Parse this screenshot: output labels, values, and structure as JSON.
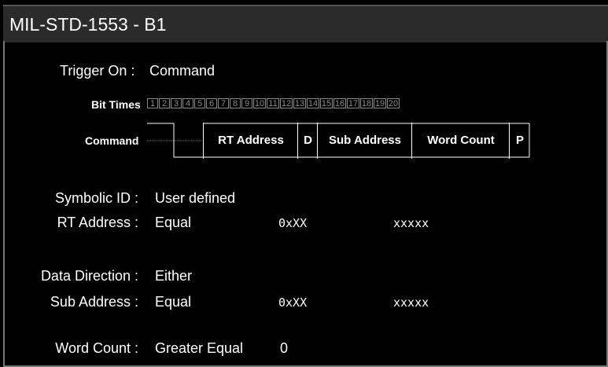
{
  "window": {
    "title": "MIL-STD-1553 - B1"
  },
  "trigger": {
    "label": "Trigger On :",
    "value": "Command"
  },
  "diagram": {
    "bit_times_label": "Bit Times",
    "bits": [
      "1",
      "2",
      "3",
      "4",
      "5",
      "6",
      "7",
      "8",
      "9",
      "10",
      "11",
      "12",
      "13",
      "14",
      "15",
      "16",
      "17",
      "18",
      "19",
      "20"
    ],
    "command_label": "Command",
    "fields": {
      "rt_address": "RT Address",
      "d": "D",
      "sub_address": "Sub Address",
      "word_count": "Word Count",
      "p": "P"
    }
  },
  "symbolic_id": {
    "label": "Symbolic ID :",
    "value": "User defined"
  },
  "rt_address": {
    "label": "RT Address :",
    "mode": "Equal",
    "hex": "0xXX",
    "bin": "xxxxx"
  },
  "data_direction": {
    "label": "Data Direction :",
    "value": "Either"
  },
  "sub_address": {
    "label": "Sub Address :",
    "mode": "Equal",
    "hex": "0xXX",
    "bin": "xxxxx"
  },
  "word_count": {
    "label": "Word Count :",
    "mode": "Greater Equal",
    "value": "0"
  },
  "colors": {
    "background": "#000000",
    "titlebar": "#2b2b2b",
    "text": "#ffffff",
    "grid": "#888888"
  }
}
